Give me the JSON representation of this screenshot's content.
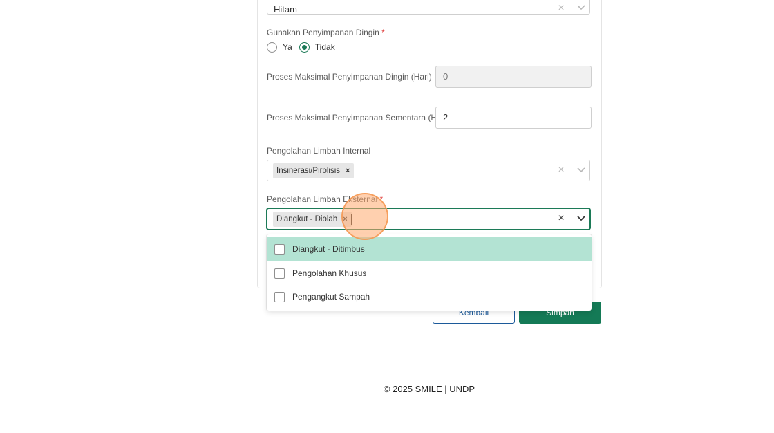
{
  "fields": {
    "color_select": {
      "value": "Hitam"
    },
    "cold_storage": {
      "label": "Gunakan Penyimpanan Dingin",
      "required_mark": "*",
      "options": [
        "Ya",
        "Tidak"
      ],
      "selected": "Tidak"
    },
    "max_cold_storage": {
      "label": "Proses Maksimal Penyimpanan Dingin (Hari)",
      "value": "0"
    },
    "max_temp_storage": {
      "label": "Proses Maksimal Penyimpanan Sementara (Hari)",
      "value": "2"
    },
    "internal_processing": {
      "label": "Pengolahan Limbah Internal",
      "tags": [
        "Insinerasi/Pirolisis"
      ]
    },
    "external_processing": {
      "label": "Pengolahan Limbah Eksternal",
      "required_mark": "*",
      "tags": [
        "Diangkut - Diolah"
      ],
      "menu_options": [
        "Diangkut - Ditimbus",
        "Pengolahan Khusus",
        "Pengangkut Sampah"
      ],
      "highlighted_option": "Diangkut - Ditimbus"
    }
  },
  "actions": {
    "back_label": "Kembali",
    "save_label": "Simpan"
  },
  "footer": {
    "text": "© 2025 SMILE | UNDP"
  },
  "colors": {
    "primary": "#147a56",
    "highlight": "#b3e3d3",
    "link_blue": "#1c5a9a",
    "required": "#e0413f"
  },
  "icons": {
    "clear": "close-icon",
    "dropdown": "chevron-down-icon",
    "tag_remove": "remove-tag-icon"
  }
}
